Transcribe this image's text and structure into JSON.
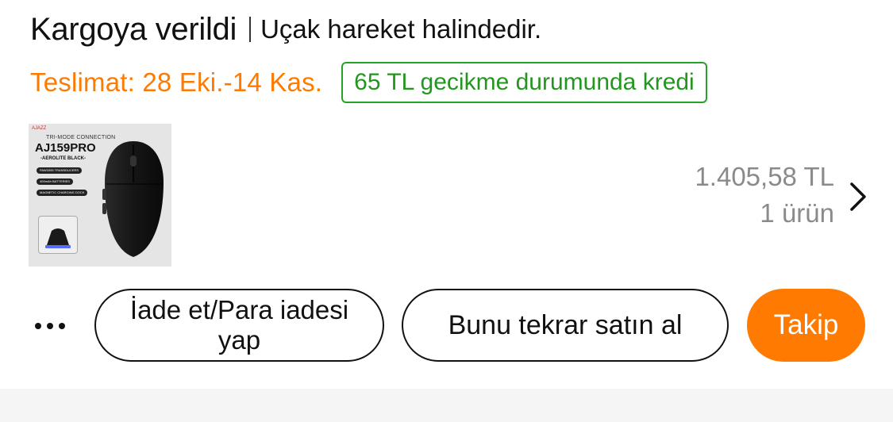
{
  "order": {
    "status_title": "Kargoya verildi",
    "status_detail": "Uçak hareket halindedir.",
    "delivery_window": "Teslimat: 28 Eki.-14 Kas.",
    "delay_credit": "65 TL gecikme durumunda kredi",
    "price": "1.405,58 TL",
    "item_count": "1 ürün"
  },
  "product_image": {
    "brand_logo": "AJAZZ",
    "mode": "TRI-MODE CONNECTION",
    "model": "AJ159PRO",
    "edition": "-AEROLITE BLACK-",
    "features": [
      "PAW3395 TRANSDUCERS",
      "400mAh BATTERIES",
      "MAGNETIC CHARGING DOCK"
    ]
  },
  "actions": {
    "more_icon": "more-horizontal-icon",
    "refund_label": "İade et/Para iadesi yap",
    "rebuy_label": "Bunu tekrar satın al",
    "track_label": "Takip",
    "chevron_icon": "chevron-right-icon"
  },
  "colors": {
    "accent_orange": "#ff7a00",
    "credit_green": "#23961f",
    "muted_text": "#8a8a8a"
  }
}
